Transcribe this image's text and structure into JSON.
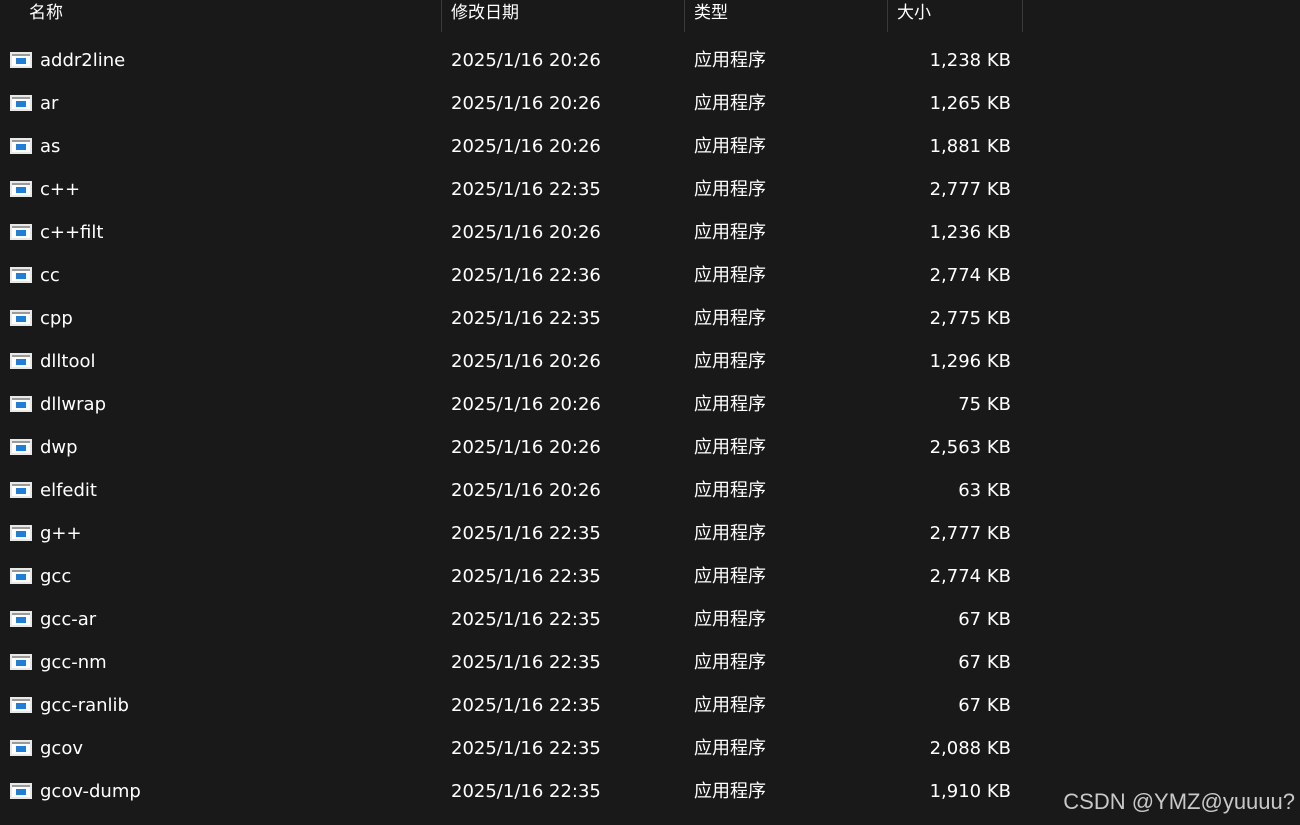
{
  "columns": {
    "name": "名称",
    "date": "修改日期",
    "type": "类型",
    "size": "大小"
  },
  "files": [
    {
      "name": "addr2line",
      "date": "2025/1/16 20:26",
      "type": "应用程序",
      "size": "1,238 KB"
    },
    {
      "name": "ar",
      "date": "2025/1/16 20:26",
      "type": "应用程序",
      "size": "1,265 KB"
    },
    {
      "name": "as",
      "date": "2025/1/16 20:26",
      "type": "应用程序",
      "size": "1,881 KB"
    },
    {
      "name": "c++",
      "date": "2025/1/16 22:35",
      "type": "应用程序",
      "size": "2,777 KB"
    },
    {
      "name": "c++filt",
      "date": "2025/1/16 20:26",
      "type": "应用程序",
      "size": "1,236 KB"
    },
    {
      "name": "cc",
      "date": "2025/1/16 22:36",
      "type": "应用程序",
      "size": "2,774 KB"
    },
    {
      "name": "cpp",
      "date": "2025/1/16 22:35",
      "type": "应用程序",
      "size": "2,775 KB"
    },
    {
      "name": "dlltool",
      "date": "2025/1/16 20:26",
      "type": "应用程序",
      "size": "1,296 KB"
    },
    {
      "name": "dllwrap",
      "date": "2025/1/16 20:26",
      "type": "应用程序",
      "size": "75 KB"
    },
    {
      "name": "dwp",
      "date": "2025/1/16 20:26",
      "type": "应用程序",
      "size": "2,563 KB"
    },
    {
      "name": "elfedit",
      "date": "2025/1/16 20:26",
      "type": "应用程序",
      "size": "63 KB"
    },
    {
      "name": "g++",
      "date": "2025/1/16 22:35",
      "type": "应用程序",
      "size": "2,777 KB"
    },
    {
      "name": "gcc",
      "date": "2025/1/16 22:35",
      "type": "应用程序",
      "size": "2,774 KB"
    },
    {
      "name": "gcc-ar",
      "date": "2025/1/16 22:35",
      "type": "应用程序",
      "size": "67 KB"
    },
    {
      "name": "gcc-nm",
      "date": "2025/1/16 22:35",
      "type": "应用程序",
      "size": "67 KB"
    },
    {
      "name": "gcc-ranlib",
      "date": "2025/1/16 22:35",
      "type": "应用程序",
      "size": "67 KB"
    },
    {
      "name": "gcov",
      "date": "2025/1/16 22:35",
      "type": "应用程序",
      "size": "2,088 KB"
    },
    {
      "name": "gcov-dump",
      "date": "2025/1/16 22:35",
      "type": "应用程序",
      "size": "1,910 KB"
    }
  ],
  "icon": "application-exe-icon",
  "watermark": "CSDN @YMZ@yuuuu?"
}
